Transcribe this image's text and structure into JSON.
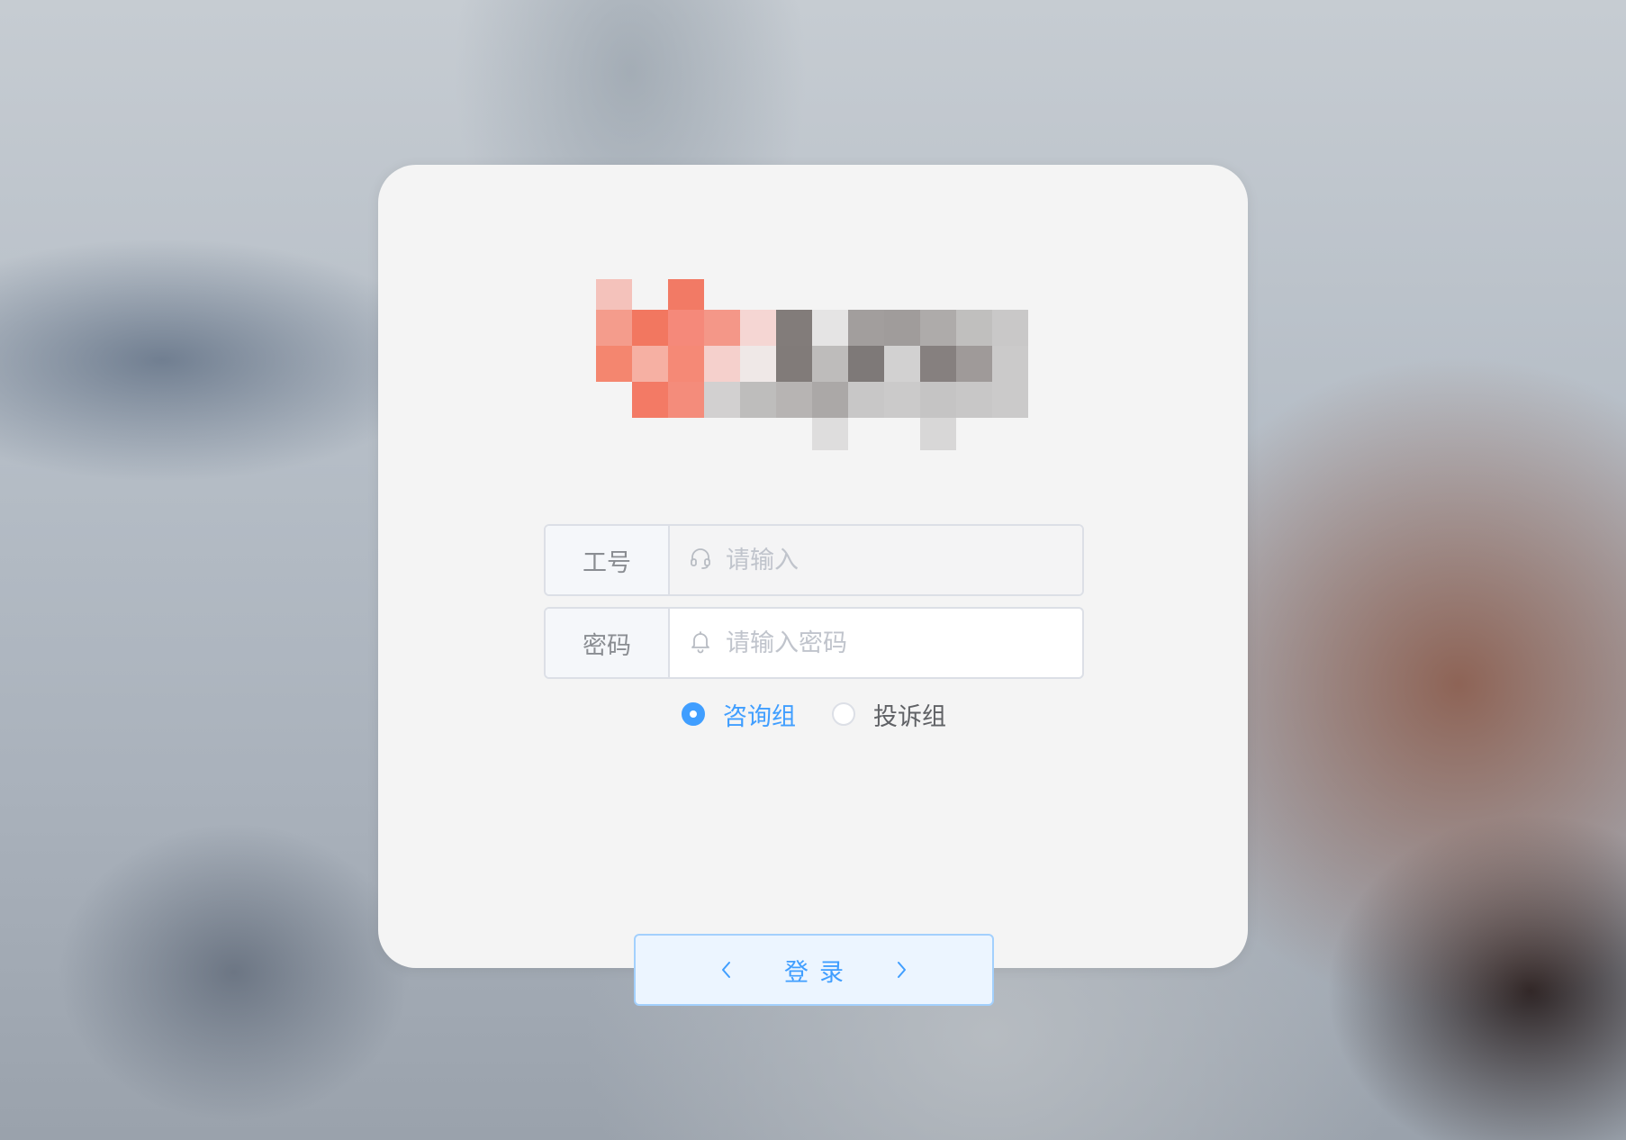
{
  "colors": {
    "accent": "#409eff",
    "card_bg": "#f4f4f4",
    "border": "#dcdfe6"
  },
  "logo": {
    "note": "pixelated brand logo"
  },
  "form": {
    "employee_id": {
      "label": "工号",
      "placeholder": "请输入",
      "value": "",
      "icon": "headset-icon"
    },
    "password": {
      "label": "密码",
      "placeholder": "请输入密码",
      "value": "",
      "icon": "bell-icon"
    },
    "group": {
      "options": [
        {
          "label": "咨询组",
          "checked": true
        },
        {
          "label": "投诉组",
          "checked": false
        }
      ]
    },
    "login_label": "登录"
  }
}
